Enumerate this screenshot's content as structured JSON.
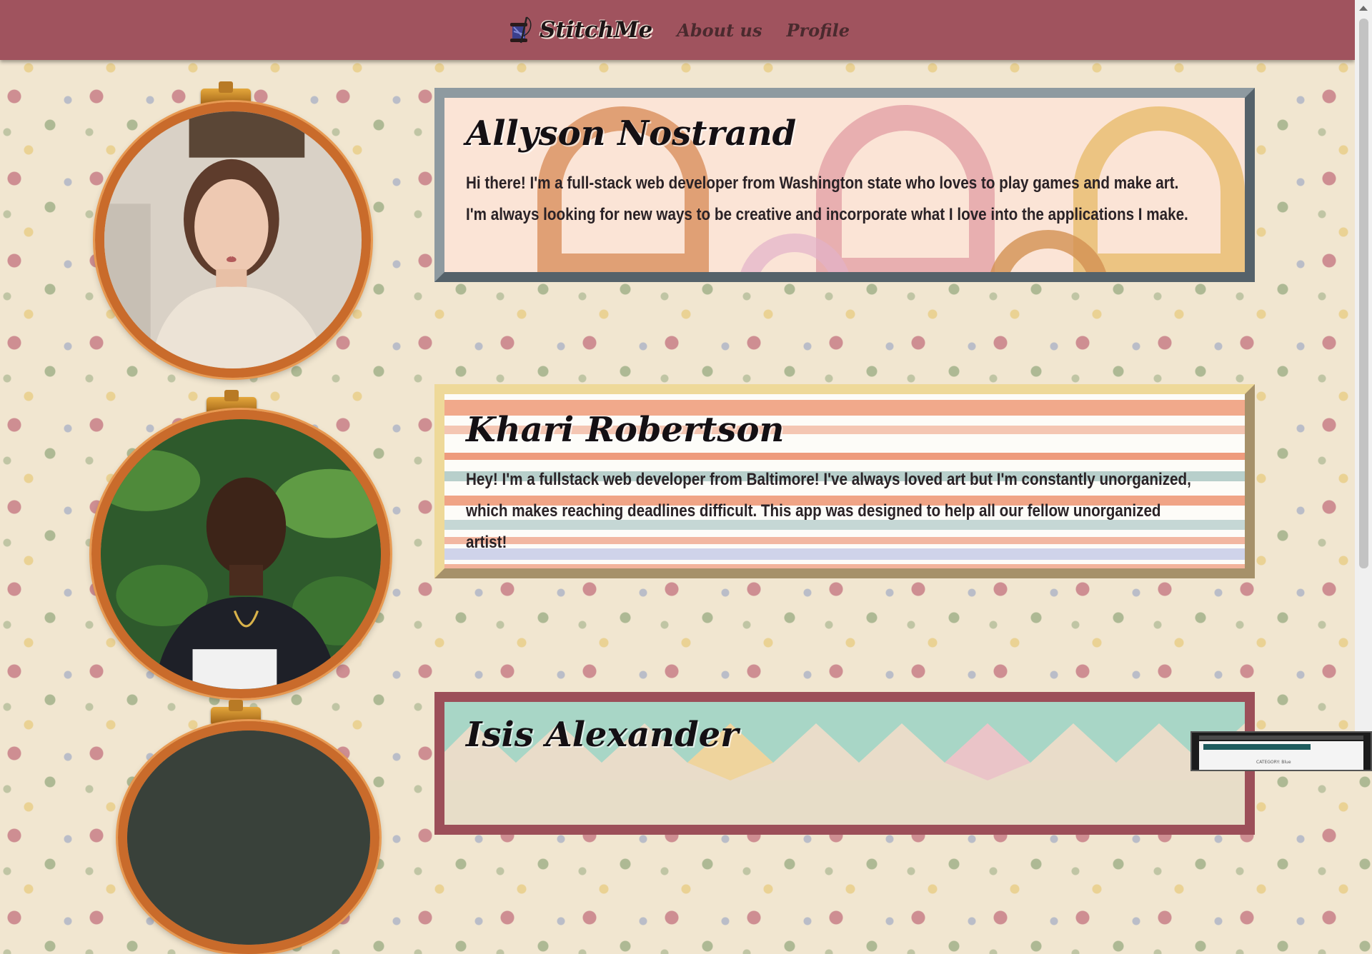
{
  "nav": {
    "brand": "StitchMe",
    "links": [
      "About us",
      "Profile"
    ]
  },
  "profiles": [
    {
      "name": "Allyson Nostrand",
      "bio": "Hi there! I'm a full-stack web developer from Washington state who loves to play games and make art. I'm always looking for new ways to be creative and incorporate what I love into the applications I make."
    },
    {
      "name": "Khari Robertson",
      "bio": "Hey! I'm a fullstack web developer from Baltimore! I've always loved art but I'm constantly unorganized, which makes reaching deadlines difficult. This app was designed to help all our fellow unorganized artist!"
    },
    {
      "name": "Isis Alexander"
    }
  ],
  "thumbnail_caption": "CATEGORY: Blue",
  "colors": {
    "navbar": "#a0535e",
    "card1_border": "#8e9aa0",
    "card2_border": "#e9d193",
    "card3_border": "#9c4f59",
    "hoop": "#c96b2b"
  }
}
